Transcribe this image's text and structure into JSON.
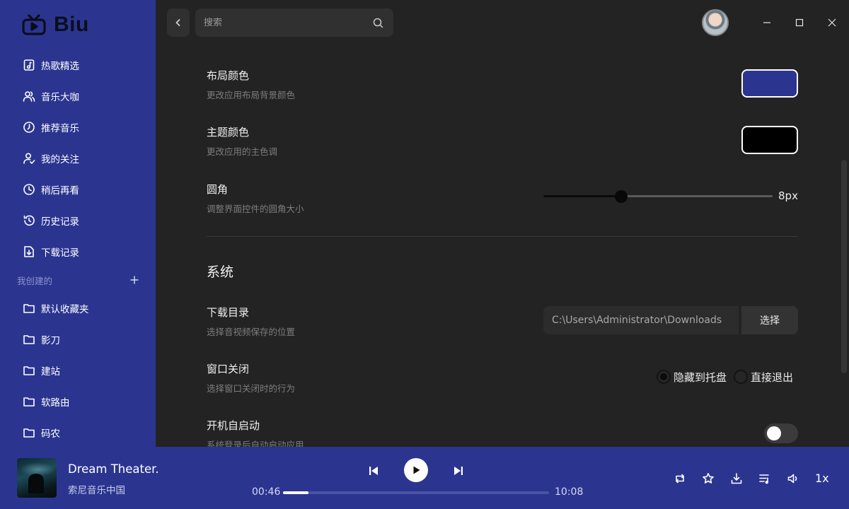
{
  "app": {
    "name": "Biu"
  },
  "colors": {
    "sidebar_bg": "#2b3590",
    "layout_color": "#2b3590",
    "theme_color": "#000000",
    "content_bg": "#232323"
  },
  "sidebar": {
    "items": [
      {
        "label": "热歌精选",
        "icon": "music-note-icon"
      },
      {
        "label": "音乐大咖",
        "icon": "users-icon"
      },
      {
        "label": "推荐音乐",
        "icon": "disc-icon"
      },
      {
        "label": "我的关注",
        "icon": "user-check-icon"
      },
      {
        "label": "稍后再看",
        "icon": "clock-icon"
      },
      {
        "label": "历史记录",
        "icon": "history-icon"
      },
      {
        "label": "下载记录",
        "icon": "file-download-icon"
      }
    ],
    "created_section": {
      "label": "我创建的",
      "add_icon": "plus-icon"
    },
    "folders": [
      {
        "label": "默认收藏夹",
        "icon": "folder-icon"
      },
      {
        "label": "影刀",
        "icon": "folder-icon"
      },
      {
        "label": "建站",
        "icon": "folder-icon"
      },
      {
        "label": "软路由",
        "icon": "folder-icon"
      },
      {
        "label": "码农",
        "icon": "folder-icon"
      }
    ]
  },
  "topbar": {
    "search_placeholder": "搜索"
  },
  "settings": {
    "layout_color": {
      "title": "布局颜色",
      "desc": "更改应用布局背景颜色"
    },
    "theme_color": {
      "title": "主题颜色",
      "desc": "更改应用的主色调"
    },
    "radius": {
      "title": "圆角",
      "desc": "调整界面控件的圆角大小",
      "value_label": "8px",
      "fraction": 0.34
    },
    "system": {
      "title": "系统",
      "download_dir": {
        "title": "下载目录",
        "desc": "选择音视频保存的位置",
        "path": "C:\\Users\\Administrator\\Downloads",
        "button": "选择"
      },
      "window_close": {
        "title": "窗口关闭",
        "desc": "选择窗口关闭时的行为",
        "options": [
          "隐藏到托盘",
          "直接退出"
        ],
        "selected": "隐藏到托盘"
      },
      "autostart": {
        "title": "开机自启动",
        "desc": "系统登录后自动启动应用",
        "enabled": false
      }
    }
  },
  "player": {
    "title": "Dream Theater...",
    "artist": "索尼音乐中国",
    "current_time": "00:46",
    "total_time": "10:08",
    "progress_fraction": 0.097,
    "speed": "1x"
  }
}
